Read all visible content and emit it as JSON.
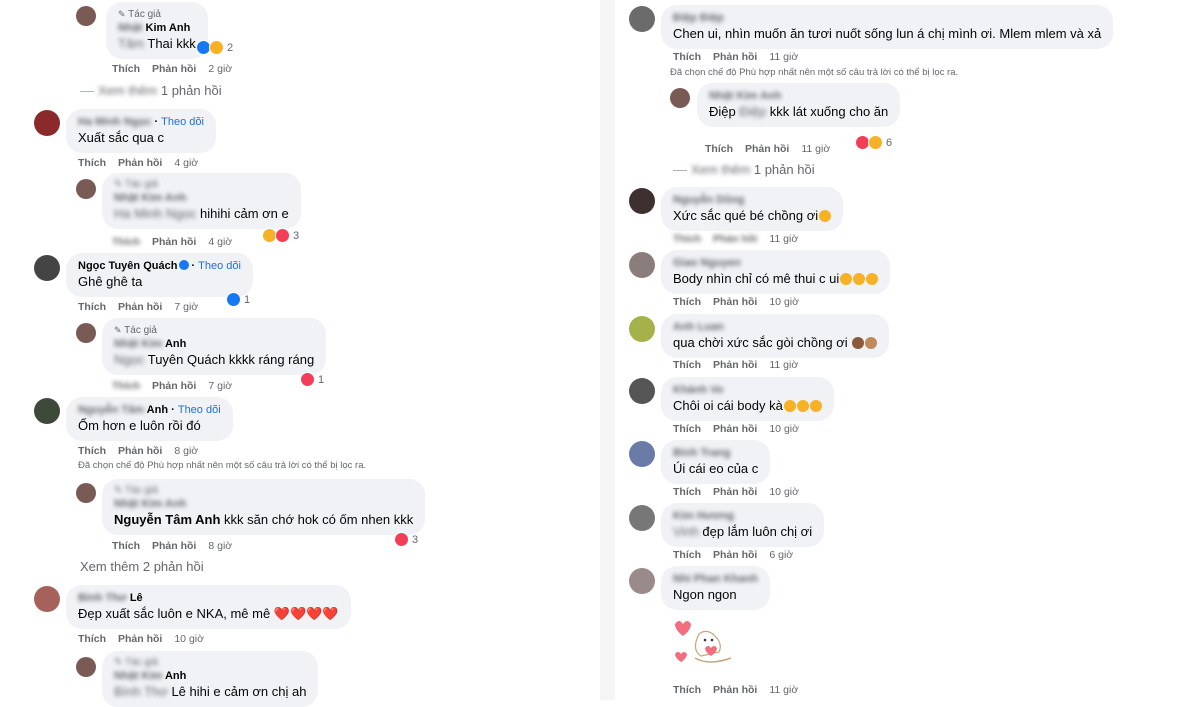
{
  "left": {
    "c1": {
      "author_tag": "Tác giả",
      "name": "Kim Anh",
      "text": "Thai kkk",
      "reaction_count": "2",
      "like": "Thích",
      "reply": "Phản hồi",
      "time": "2 giờ"
    },
    "more1": "1 phản hồi",
    "c2": {
      "name": "Ha Minh Ngọc",
      "follow": "Theo dõi",
      "text": "Xuất sắc qua c",
      "like": "Thích",
      "reply": "Phản hồi",
      "time": "4 giờ"
    },
    "c3": {
      "mention": "Ha Minh Ngọc",
      "text": "hihihi cảm ơn e",
      "reaction_count": "3",
      "reply": "Phản hồi",
      "time": "4 giờ"
    },
    "c4": {
      "name": "Ngọc Tuyên Quách",
      "follow": "Theo dõi",
      "text": "Ghê ghê ta",
      "reaction_count": "1",
      "like": "Thích",
      "reply": "Phản hồi",
      "time": "7 giờ"
    },
    "c5": {
      "author_tag": "Tác giả",
      "name": "Anh",
      "mention": "Tuyên Quách",
      "text": "kkkk ráng ráng",
      "reaction_count": "1",
      "reply": "Phản hồi",
      "time": "7 giờ"
    },
    "c6": {
      "name": "Anh",
      "follow": "Theo dõi",
      "text": "Ốm hơn e luôn rồi đó",
      "like": "Thích",
      "reply": "Phản hồi",
      "time": "8 giờ"
    },
    "note1": "Đã chọn chế độ Phù hợp nhất nên một số câu trả lời có thể bị lọc ra.",
    "c7": {
      "mention": "Nguyễn Tâm Anh",
      "text": "kkk săn chớ hok có ốm nhen kkk",
      "reaction_count": "3",
      "like": "Thích",
      "reply": "Phản hồi",
      "time": "8 giờ"
    },
    "more2": "Xem thêm 2 phản hồi",
    "c8": {
      "name": "Lê",
      "text": "Đẹp xuất sắc luôn e NKA, mê mê",
      "hearts": "❤️❤️❤️❤️",
      "like": "Thích",
      "reply": "Phản hồi",
      "time": "10 giờ"
    },
    "c9": {
      "name": "Anh",
      "mention": "Lê",
      "text": "hihi e cảm ơn chị ah"
    }
  },
  "right": {
    "r1": {
      "name": "Điệp",
      "text": "Chen ui, nhìn muốn ăn tươi nuốt sống lun á chị mình ơi. Mlem mlem và xả",
      "like": "Thích",
      "reply": "Phản hồi",
      "time": "11 giờ"
    },
    "note": "Đã chọn chế độ Phù hợp nhất nên một số câu trả lời có thể bị lọc ra.",
    "r2": {
      "name": "Anh",
      "mention": "Điệp",
      "text": "kkk lát xuống cho ăn",
      "reaction_count": "6",
      "like": "Thích",
      "reply": "Phản hồi",
      "time": "11 giờ"
    },
    "more": "1 phản hồi",
    "r3": {
      "name": "Dũng",
      "text": "Xức sắc qué bé chồng ơi",
      "reply": "Phản hồi",
      "time": "11 giờ"
    },
    "r4": {
      "name": "Nguyen",
      "text": "Body nhìn chỉ có mê thui c ui",
      "like": "Thích",
      "reply": "Phản hồi",
      "time": "10 giờ"
    },
    "r5": {
      "name": "Luan",
      "text": "qua chời xức sắc gòi chồng ơi",
      "like": "Thích",
      "reply": "Phản hồi",
      "time": "11 giờ"
    },
    "r6": {
      "name": "Vo",
      "text": "Chôi oi cái body kà",
      "like": "Thích",
      "reply": "Phản hồi",
      "time": "10 giờ"
    },
    "r7": {
      "name": "Trang",
      "text": "Úi cái eo của c",
      "like": "Thích",
      "reply": "Phản hồi",
      "time": "10 giờ"
    },
    "r8": {
      "name": "Kim Hương",
      "text": "đẹp lắm luôn chị ơi",
      "like": "Thích",
      "reply": "Phản hồi",
      "time": "6 giờ"
    },
    "r9": {
      "name": "Khanh",
      "text": "Ngon ngon",
      "like": "Thích",
      "reply": "Phản hồi",
      "time": "11 giờ"
    }
  },
  "colors": {
    "bubble": "#f0f2f5",
    "link": "#216fdb",
    "muted": "#65676b",
    "like": "#1877f2",
    "heart": "#f33e58"
  }
}
